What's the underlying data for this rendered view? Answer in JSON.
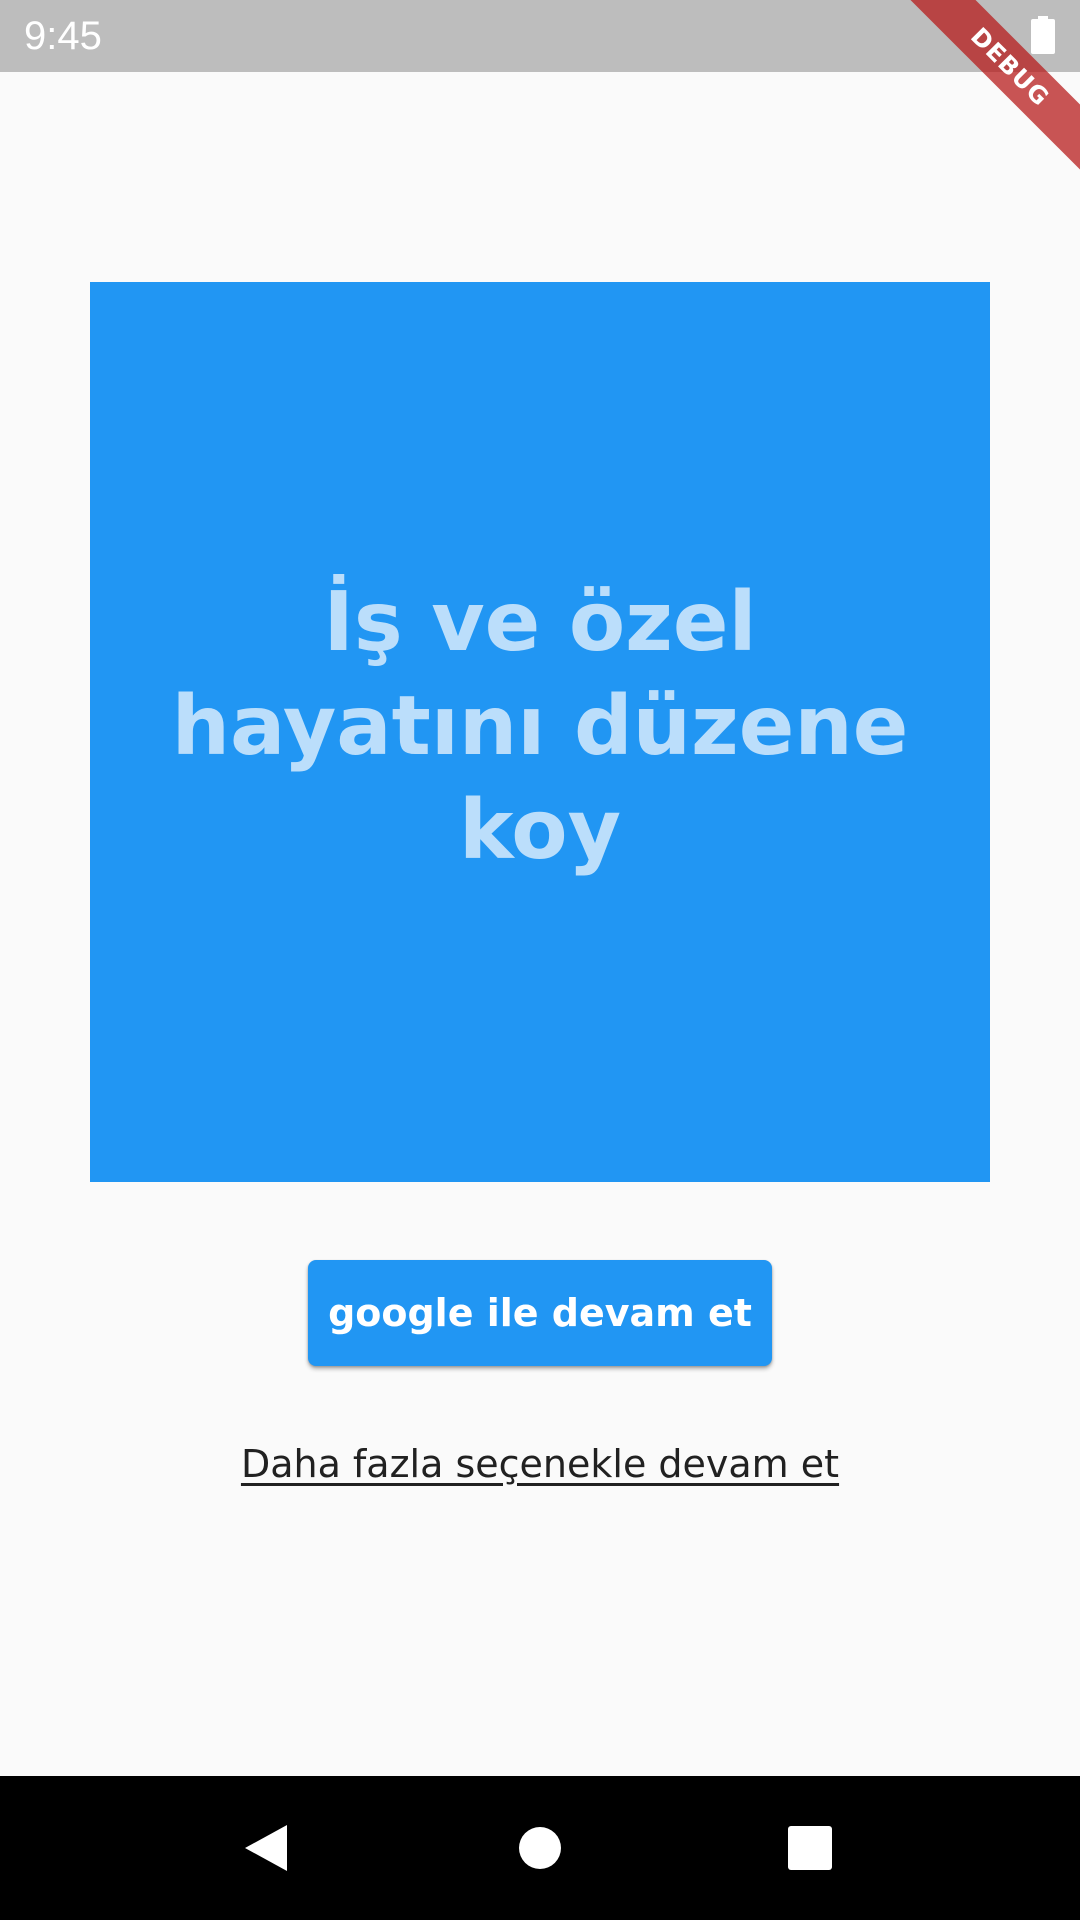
{
  "status_bar": {
    "time": "9:45",
    "battery_icon": "battery-full-icon"
  },
  "debug_banner": {
    "label": "DEBUG"
  },
  "hero": {
    "text": "İş ve özel hayatını düzene koy",
    "background_color": "#2196f3",
    "text_color": "#bbdefb"
  },
  "actions": {
    "google_button_label": "google ile devam et",
    "more_options_label": "Daha fazla seçenekle devam et"
  },
  "nav_bar": {
    "back_icon": "back-triangle-icon",
    "home_icon": "home-circle-icon",
    "recents_icon": "recents-square-icon"
  },
  "colors": {
    "accent": "#2196f3",
    "status_bar": "#bdbdbd",
    "background": "#fafafa",
    "nav_bar": "#000000"
  }
}
